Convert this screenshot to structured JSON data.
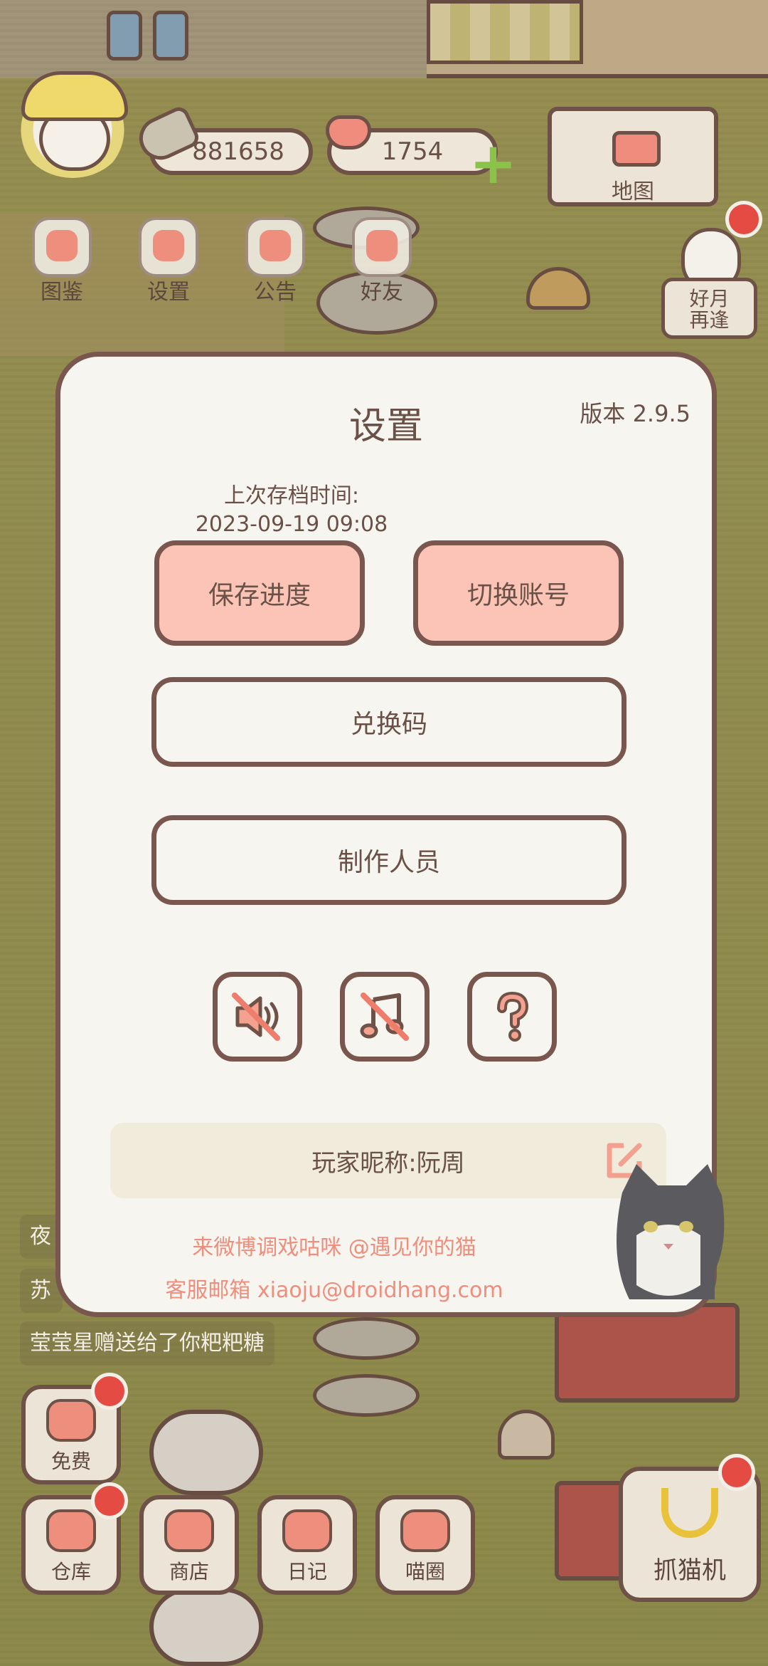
{
  "hud": {
    "coins": "881658",
    "hearts": "1754",
    "map_label": "地图",
    "event_label_line1": "好月",
    "event_label_line2": "再逢"
  },
  "top_menu": [
    {
      "label": "图鉴",
      "icon": "cat-book-icon"
    },
    {
      "label": "设置",
      "icon": "gear-icon"
    },
    {
      "label": "公告",
      "icon": "gift-icon"
    },
    {
      "label": "好友",
      "icon": "friends-icon"
    }
  ],
  "chat": {
    "line1": "夜",
    "line2": "苏",
    "line3": "莹莹星赠送给了你粑粑糖"
  },
  "bottom_bar": [
    {
      "label": "免费",
      "icon": "heart-icon",
      "badge": true
    },
    {
      "label": "仓库",
      "icon": "warehouse-icon",
      "badge": true
    },
    {
      "label": "商店",
      "icon": "shop-icon",
      "badge": false
    },
    {
      "label": "日记",
      "icon": "diary-icon",
      "badge": false
    },
    {
      "label": "喵圈",
      "icon": "cat-planet-icon",
      "badge": false
    }
  ],
  "claw_machine": {
    "label": "抓猫机",
    "icon": "claw-icon",
    "badge": true
  },
  "settings": {
    "title": "设置",
    "version": "版本 2.9.5",
    "last_save_label": "上次存档时间:",
    "last_save_time": "2023-09-19 09:08",
    "save_button": "保存进度",
    "switch_account_button": "切换账号",
    "redeem_code_button": "兑换码",
    "credits_button": "制作人员",
    "sound_toggle": {
      "icon": "sound-muted-icon",
      "state": "muted"
    },
    "music_toggle": {
      "icon": "music-muted-icon",
      "state": "muted"
    },
    "help_icon": "help-icon",
    "nickname_label": "玩家昵称:阮周",
    "weibo_text": "来微博调戏咕咪 @遇见你的猫",
    "email_text": "客服邮箱 xiaoju@droidhang.com"
  },
  "colors": {
    "accent_pink": "#fcc4b6",
    "border_brown": "#7a574e",
    "panel_bg": "#f7f5ef",
    "link_salmon": "#ef8e7c",
    "badge_red": "#e34b43"
  }
}
